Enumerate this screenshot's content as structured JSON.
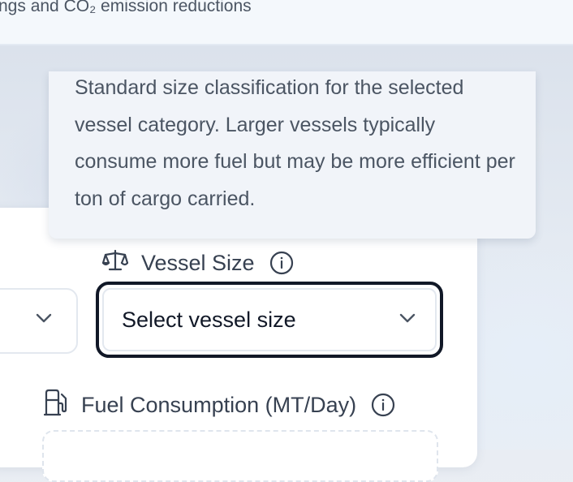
{
  "header": {
    "subtitle": "ngs and CO₂ emission reductions"
  },
  "tooltip": {
    "text": "Standard size classification for the selected vessel category. Larger vessels typically consume more fuel but may be more efficient per ton of cargo carried."
  },
  "form": {
    "vessel_size": {
      "label": "Vessel Size",
      "icon": "scale-icon",
      "info_icon": "info-icon",
      "placeholder": "Select vessel size"
    },
    "vessel_category": {
      "value": ""
    },
    "fuel_consumption": {
      "label": "Fuel Consumption (MT/Day)",
      "icon": "fuel-pump-icon",
      "info_icon": "info-icon",
      "value": ""
    }
  },
  "colors": {
    "focus_border": "#111827",
    "label_text": "#374151",
    "muted_text": "#4b5563"
  }
}
